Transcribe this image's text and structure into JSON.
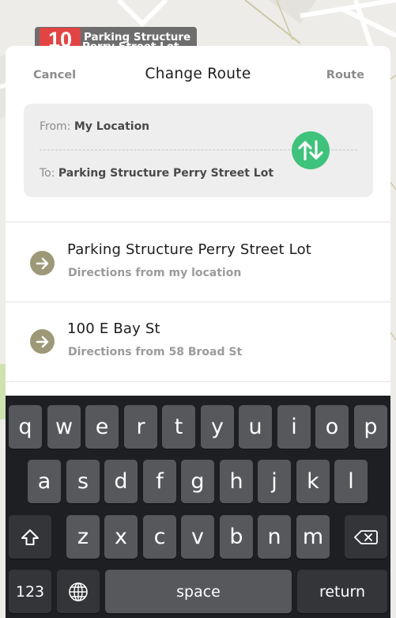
{
  "map_pin": {
    "number": "10",
    "line1": "Parking Structure",
    "line2": "Perry Street Lot",
    "color": "#e24444"
  },
  "nav": {
    "cancel": "Cancel",
    "title": "Change Route",
    "route": "Route"
  },
  "route_box": {
    "from_label": "From:",
    "from_value": "My Location",
    "to_label": "To:",
    "to_value": "Parking Structure Perry Street Lot",
    "swap_icon": "swap-vertical-icon",
    "swap_color": "#3fc27b"
  },
  "suggestions": [
    {
      "name": "Parking Structure Perry Street Lot",
      "sub": "Directions from my location",
      "icon": "arrow-right-icon"
    },
    {
      "name": "100 E Bay St",
      "sub": "Directions from 58 Broad St",
      "icon": "arrow-right-icon"
    }
  ],
  "keyboard": {
    "row1": [
      "q",
      "w",
      "e",
      "r",
      "t",
      "y",
      "u",
      "i",
      "o",
      "p"
    ],
    "row2": [
      "a",
      "s",
      "d",
      "f",
      "g",
      "h",
      "j",
      "k",
      "l"
    ],
    "row3": [
      "z",
      "x",
      "c",
      "v",
      "b",
      "n",
      "m"
    ],
    "numbers": "123",
    "space": "space",
    "return": "return",
    "shift_icon": "shift-icon",
    "delete_icon": "delete-icon",
    "globe_icon": "globe-icon"
  }
}
